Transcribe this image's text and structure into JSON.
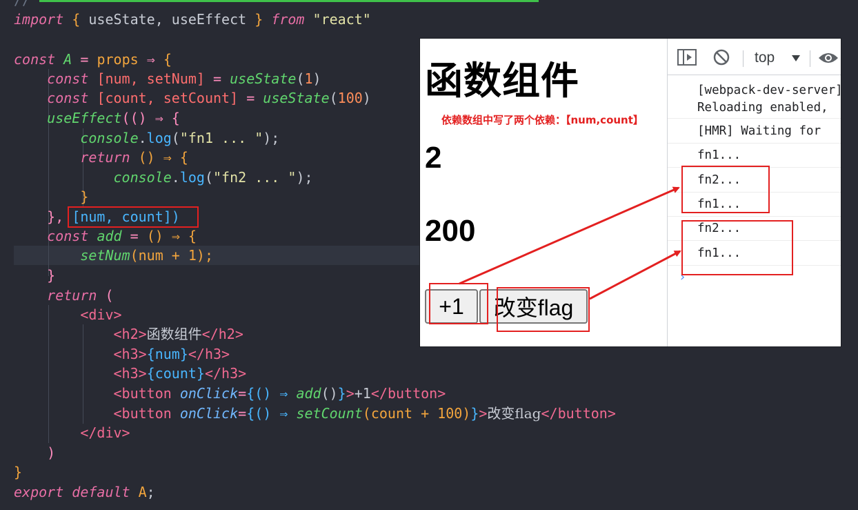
{
  "code": {
    "import": {
      "kw": "import",
      "open": "{",
      "names": "useState, useEffect",
      "close": "}",
      "from": "from",
      "module": "\"react\""
    },
    "component_decl": {
      "kw": "const",
      "name": "A",
      "eq": "=",
      "param": "props",
      "arrow": "⇒",
      "open": "{"
    },
    "state1": {
      "kw": "const",
      "destructure": "[num, setNum]",
      "eq": "=",
      "fn": "useState",
      "arg": "1"
    },
    "state2": {
      "kw": "const",
      "destructure": "[count, setCount]",
      "eq": "=",
      "fn": "useState",
      "arg": "100"
    },
    "effect": {
      "fn": "useEffect",
      "args_open": "(() ⇒ {"
    },
    "log1": {
      "obj": "console",
      "method": "log",
      "arg": "\"fn1 ... \"",
      "end": ");"
    },
    "ret_fn": {
      "kw": "return",
      "sig": "() ⇒ {"
    },
    "log2": {
      "obj": "console",
      "method": "log",
      "arg": "\"fn2 ... \"",
      "end": ");"
    },
    "inner_close": "}",
    "effect_close": {
      "brace": "},",
      "deps": "[num, count])"
    },
    "add_decl": {
      "kw": "const",
      "name": "add",
      "eq": "=",
      "sig": "() ⇒ {"
    },
    "add_body": {
      "fn": "setNum",
      "args": "(num + 1);"
    },
    "add_close": "}",
    "return": {
      "kw": "return",
      "open": "("
    },
    "jsx_div_open": "<div>",
    "jsx_h2": {
      "open": "<h2>",
      "text": "函数组件",
      "close": "</h2>"
    },
    "jsx_h3_num": {
      "open": "<h3>",
      "expr": "{num}",
      "close": "</h3>"
    },
    "jsx_h3_count": {
      "open": "<h3>",
      "expr": "{count}",
      "close": "</h3>"
    },
    "jsx_btn1": {
      "open": "<button",
      "attr": "onClick",
      "eq": "=",
      "expr_open": "{() ⇒",
      "call": "add",
      "call_args": "()",
      "expr_close": "}",
      "gt": ">",
      "text": "+1",
      "close": "</button>"
    },
    "jsx_btn2": {
      "open": "<button",
      "attr": "onClick",
      "eq": "=",
      "expr_open": "{() ⇒",
      "call": "setCount",
      "call_args": "(count + 100)",
      "expr_close": "}",
      "gt": ">",
      "text": "改变flag",
      "close": "</button>"
    },
    "jsx_div_close": "</div>",
    "return_close": ")",
    "component_close": "}",
    "export": {
      "kw": "export default",
      "name": "A",
      "end": ";"
    }
  },
  "preview": {
    "title": "函数组件",
    "annotation": "依赖数组中写了两个依赖：【num,count】",
    "num": "2",
    "count": "200",
    "button_add": "+1",
    "button_flag": "改变flag"
  },
  "devtools": {
    "context": "top",
    "logs": [
      "[webpack-dev-server]\nReloading enabled,",
      "[HMR] Waiting for",
      "fn1...",
      "fn2...",
      "fn1...",
      "fn2...",
      "fn1..."
    ]
  },
  "colors": {
    "editor_bg": "#282a33",
    "highlight_red": "#e32020",
    "accent_green": "#3fc14a"
  }
}
